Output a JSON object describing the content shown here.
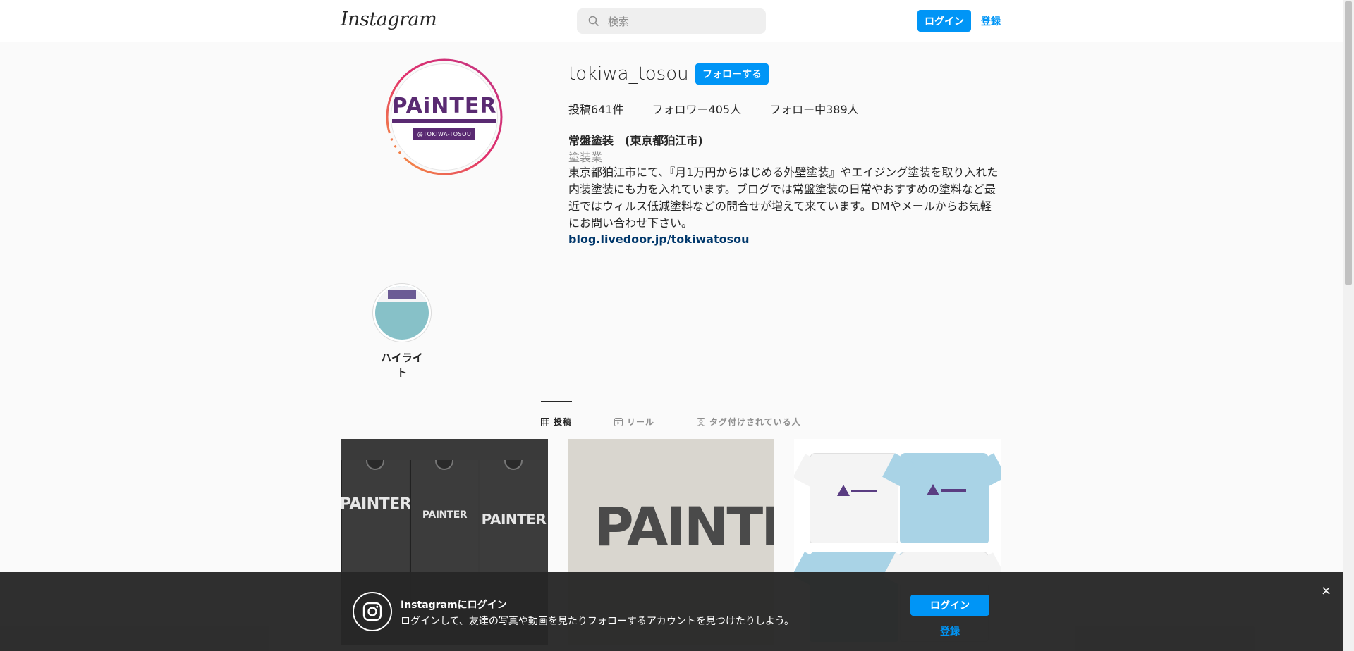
{
  "nav": {
    "logo": "Instagram",
    "search_placeholder": "検索",
    "login_label": "ログイン",
    "register_label": "登録"
  },
  "profile": {
    "username": "tokiwa_tosou",
    "follow_label": "フォローする",
    "stats": {
      "posts": "投稿641件",
      "followers": "フォロワー405人",
      "following": "フォロー中389人"
    },
    "full_name": "常盤塗装　(東京都狛江市)",
    "category": "塗装業",
    "bio": "東京都狛江市にて、『月1万円からはじめる外壁塗装』やエイジング塗装を取り入れた内装塗装にも力を入れています。ブログでは常盤塗装の日常やおすすめの塗料など最近ではウィルス低減塗料などの問合せが増えて来ています。DMやメールからお気軽にお問い合わせ下さい。",
    "link": "blog.livedoor.jp/tokiwatosou",
    "avatar": {
      "brand": "PAiNTER",
      "sub": "@TOKIWA-TOSOU"
    }
  },
  "highlights": [
    {
      "label": "ハイライト"
    }
  ],
  "tabs": [
    {
      "label": "投稿",
      "icon": "grid-icon",
      "active": true
    },
    {
      "label": "リール",
      "icon": "reel-icon",
      "active": false
    },
    {
      "label": "タグ付けされている人",
      "icon": "tag-person-icon",
      "active": false
    }
  ],
  "posts": {
    "post1": {
      "shirt1": "PAINTER",
      "shirt2": "PAINTER",
      "shirt3": "PAINTER"
    },
    "post2": {
      "text": "PAINTER"
    }
  },
  "login_banner": {
    "title": "Instagramにログイン",
    "description": "ログインして、友達の写真や動画を見たりフォローするアカウントを見つけたりしよう。",
    "login_label": "ログイン",
    "register_label": "登録",
    "close_label": "×"
  },
  "colors": {
    "accent": "#0095f6",
    "link": "#00376b",
    "brand_purple": "#5a2a72"
  }
}
